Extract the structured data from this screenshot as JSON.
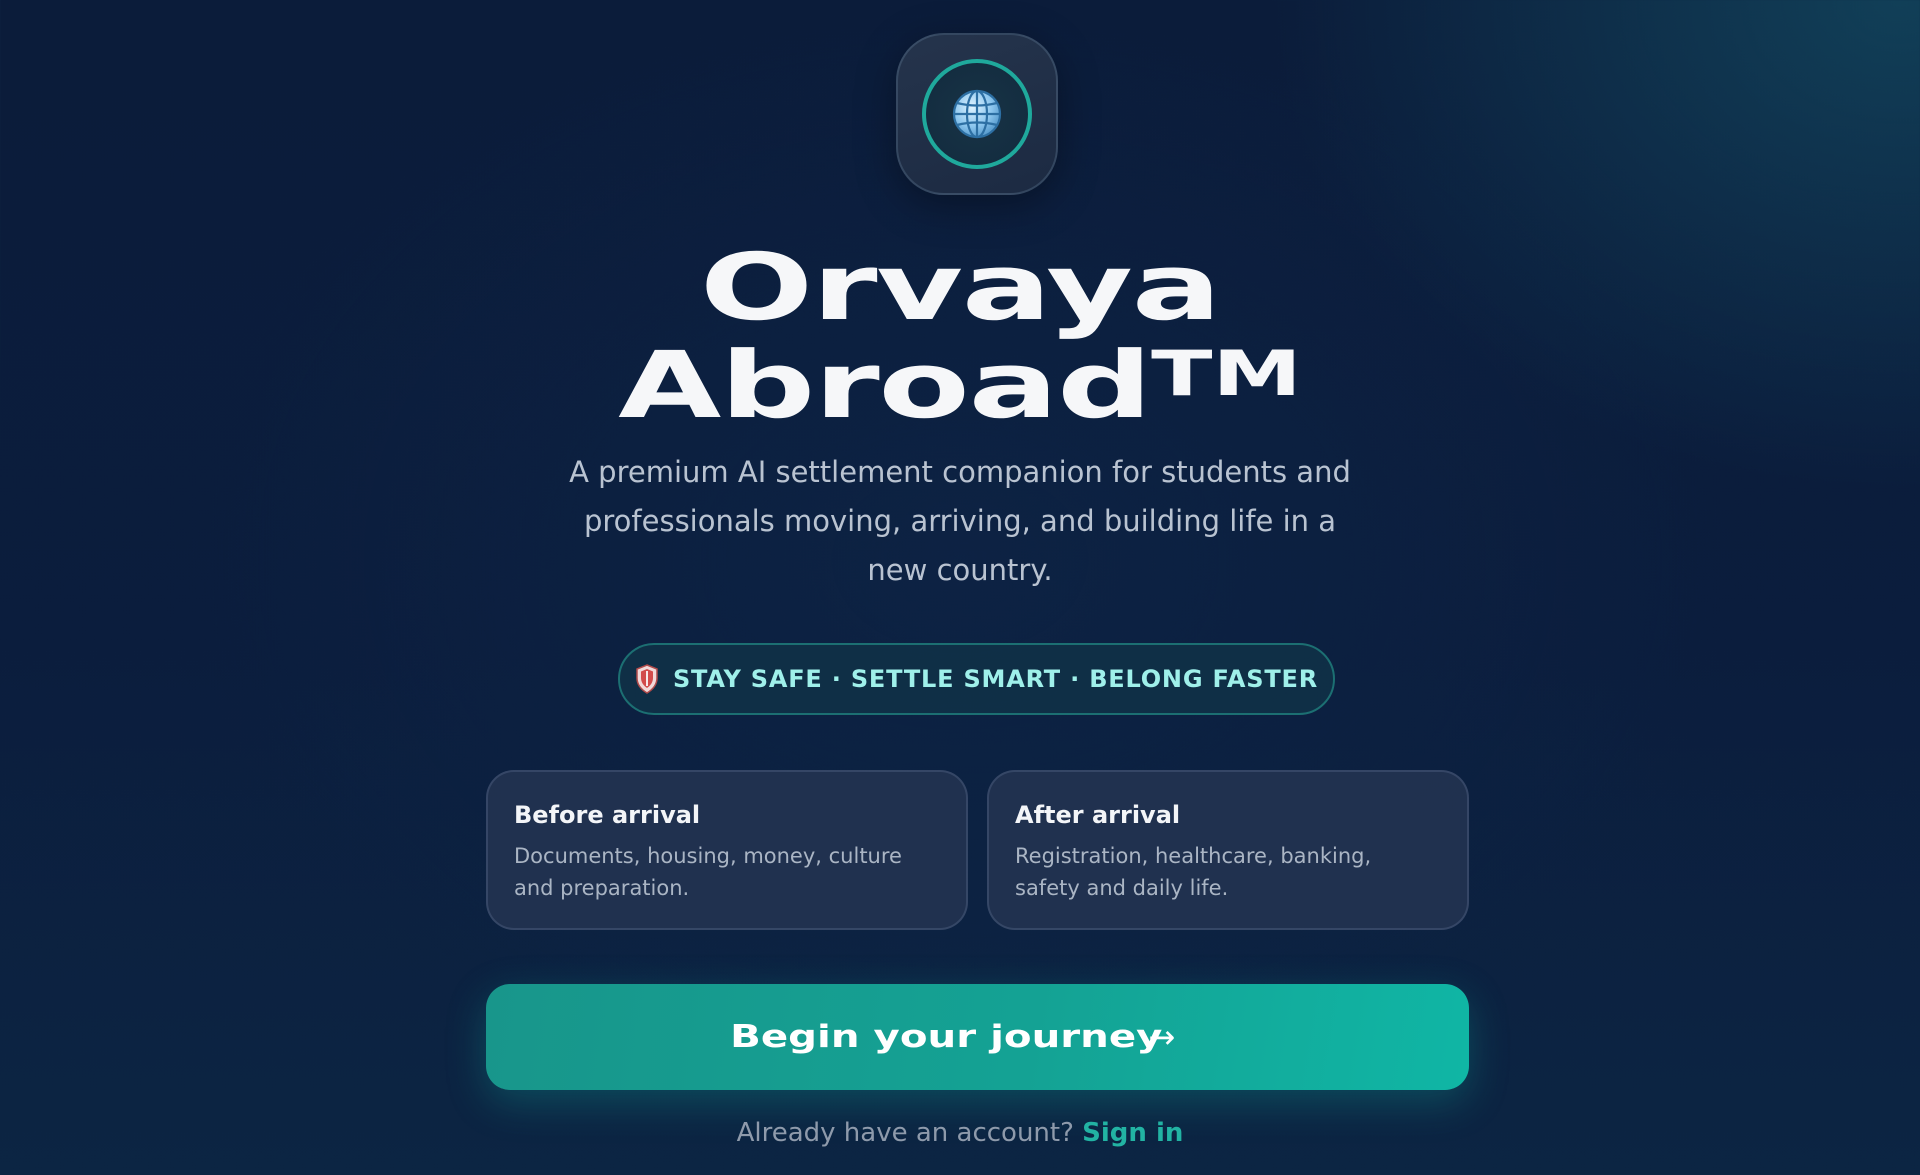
{
  "brand": {
    "name_line1": "Orvaya",
    "name_line2": "Abroad",
    "trademark": "TM",
    "icon": "globe-icon"
  },
  "hero": {
    "tagline": "A premium AI settlement companion for students and professionals moving, arriving, and building life in a new country.",
    "pill_icon": "shield-icon",
    "pill_text": "STAY SAFE · SETTLE SMART · BELONG FASTER"
  },
  "cards": [
    {
      "title": "Before arrival",
      "description": "Documents, housing, money, culture and preparation."
    },
    {
      "title": "After arrival",
      "description": "Registration, healthcare, banking, safety and daily life."
    }
  ],
  "cta": {
    "label": "Begin your journey",
    "arrow": "→"
  },
  "signin": {
    "prompt": "Already have an account?",
    "link_label": "Sign in"
  },
  "colors": {
    "accent": "#14a294",
    "pill_text": "#9ff0ea",
    "link": "#22b3a3",
    "background": "#0b1c3a"
  }
}
